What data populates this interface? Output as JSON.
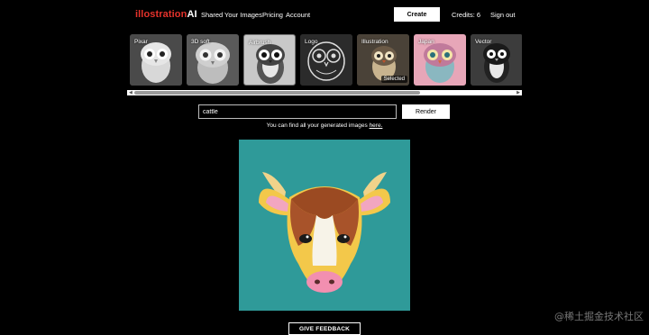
{
  "brand": {
    "prefix": "illostration",
    "suffix": "AI"
  },
  "nav": [
    "Shared",
    "Your Images",
    "Pricing",
    "Account"
  ],
  "create_label": "Create",
  "credits": "Credits: 6",
  "signout": "Sign out",
  "styles": [
    {
      "label": "Pixar",
      "icon": "owl-pixar-icon"
    },
    {
      "label": "3D soft",
      "icon": "owl-3d-icon"
    },
    {
      "label": "Airbrush",
      "icon": "owl-airbrush-icon"
    },
    {
      "label": "Logo",
      "icon": "owl-logo-icon"
    },
    {
      "label": "Illustration",
      "icon": "owl-illustration-icon",
      "selected": true,
      "badge": "Selected"
    },
    {
      "label": "Japan",
      "icon": "owl-japan-icon"
    },
    {
      "label": "Vector",
      "icon": "owl-vector-icon"
    }
  ],
  "prompt": {
    "value": "cattle"
  },
  "render_label": "Render",
  "hint": {
    "text": "You can find all your generated images ",
    "link": "here."
  },
  "result_image": {
    "subject": "cattle-illustration"
  },
  "feedback_label": "GIVE FEEDBACK",
  "watermark": "@稀土掘金技术社区",
  "colors": {
    "brand_red": "#e4322b",
    "background": "#000000",
    "result_bg": "#2f9a99"
  }
}
